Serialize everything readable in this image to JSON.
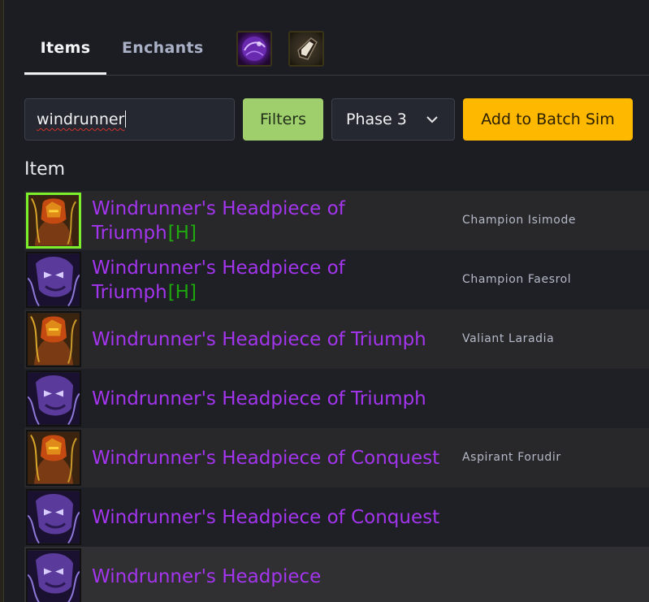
{
  "tabs": [
    {
      "label": "Items",
      "active": true
    },
    {
      "label": "Enchants",
      "active": false
    }
  ],
  "gem_icons": [
    "purple-orb-icon",
    "stone-shard-icon"
  ],
  "search": {
    "value": "windrunner"
  },
  "filters_label": "Filters",
  "phase_select": {
    "value": "Phase 3"
  },
  "batch_label": "Add to Batch Sim",
  "column_header": "Item",
  "colors": {
    "epic": "#a335ee",
    "heroic": "#1eff00",
    "accent_yellow": "#ffb800",
    "filters_green": "#9fcf6c"
  },
  "rows": [
    {
      "name": "Windrunner's Headpiece of",
      "name_line2": "Triumph",
      "tag": "[H]",
      "source": "Champion Isimode",
      "icon": "blood-elf-hunter-portrait-icon",
      "selected": true
    },
    {
      "name": "Windrunner's Headpiece of",
      "name_line2": "Triumph",
      "tag": "[H]",
      "source": "Champion Faesrol",
      "icon": "undead-hunter-portrait-icon",
      "selected": false
    },
    {
      "name": "Windrunner's Headpiece of Triumph",
      "name_line2": "",
      "tag": "",
      "source": "Valiant Laradia",
      "icon": "blood-elf-hunter-portrait-icon",
      "selected": false
    },
    {
      "name": "Windrunner's Headpiece of Triumph",
      "name_line2": "",
      "tag": "",
      "source": "",
      "icon": "undead-hunter-portrait-icon",
      "selected": false
    },
    {
      "name": "Windrunner's Headpiece of Conquest",
      "name_line2": "",
      "tag": "",
      "source": "Aspirant Forudir",
      "icon": "blood-elf-hunter-portrait-icon",
      "selected": false
    },
    {
      "name": "Windrunner's Headpiece of Conquest",
      "name_line2": "",
      "tag": "",
      "source": "",
      "icon": "undead-hunter-portrait-icon",
      "selected": false
    },
    {
      "name": "Windrunner's Headpiece",
      "name_line2": "",
      "tag": "",
      "source": "",
      "icon": "undead-hunter-portrait-icon",
      "selected": false
    }
  ]
}
